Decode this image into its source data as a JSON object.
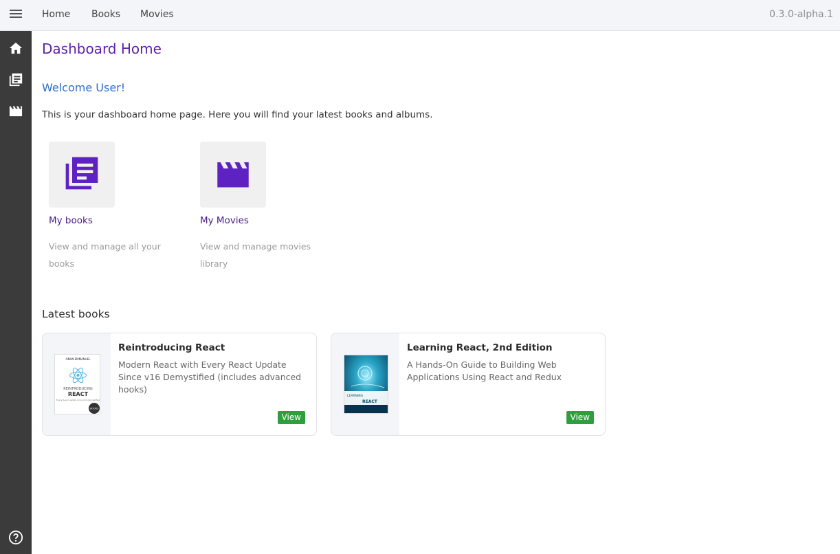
{
  "topbar": {
    "nav": [
      "Home",
      "Books",
      "Movies"
    ],
    "version": "0.3.0-alpha.1"
  },
  "rail": {
    "icons": [
      "menu-icon",
      "home-icon",
      "books-icon",
      "movies-icon",
      "help-icon"
    ]
  },
  "main": {
    "title": "Dashboard Home",
    "welcome": "Welcome User!",
    "intro": "This is your dashboard home page. Here you will find your latest books and albums.",
    "quick_links": [
      {
        "title": "My books",
        "description": "View and manage all your books",
        "icon": "books-icon"
      },
      {
        "title": "My Movies",
        "description": "View and manage movies library",
        "icon": "clapperboard-icon"
      }
    ],
    "latest_books_title": "Latest books",
    "books": [
      {
        "title": "Reintroducing React",
        "subtitle": "Modern React with Every React Update Since v16 Demystified (includes advanced hooks)",
        "view_label": "View",
        "cover": {
          "author": "ONAN EMMANUEL",
          "line1": "REINTRODUCING",
          "line2": "REACT",
          "tagline": "Every React update since v16 demystified",
          "badge": "HOOKS"
        }
      },
      {
        "title": "Learning React, 2nd Edition",
        "subtitle": "A Hands-On Guide to Building Web Applications Using React and Redux",
        "view_label": "View",
        "cover": {
          "line1": "LEARNING",
          "line2": "REACT"
        }
      }
    ]
  },
  "colors": {
    "rail_bg": "#3b3b3b",
    "topbar_bg": "#f4f5f8",
    "title_purple": "#5b1fa8",
    "welcome_blue": "#2f6fce",
    "icon_purple": "#5e22c2",
    "view_green": "#2e9f3e"
  }
}
